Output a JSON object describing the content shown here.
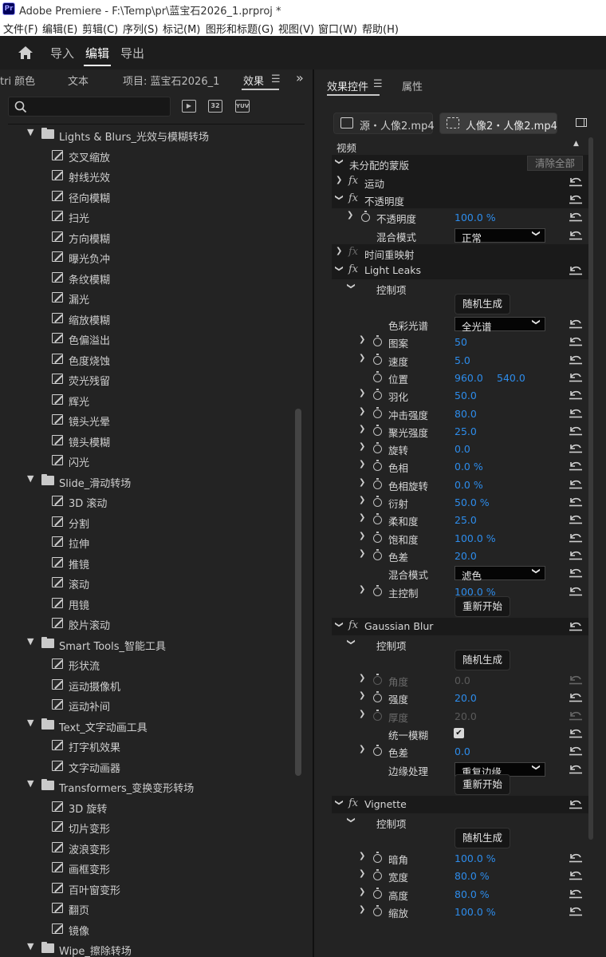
{
  "titlebar": {
    "logo": "Pr",
    "title": "Adobe Premiere - F:\\Temp\\pr\\蓝宝石2026_1.prproj *"
  },
  "menubar": [
    "文件(F)",
    "编辑(E)",
    "剪辑(C)",
    "序列(S)",
    "标记(M)",
    "图形和标题(G)",
    "视图(V)",
    "窗口(W)",
    "帮助(H)"
  ],
  "workspace": {
    "tabs": [
      "导入",
      "编辑",
      "导出"
    ],
    "active": "编辑"
  },
  "left_panel": {
    "tabs": [
      "tri 颜色",
      "文本",
      "项目: 蓝宝石2026_1",
      "效果"
    ],
    "active_tab": "效果",
    "search": {
      "value": "",
      "placeholder": ""
    },
    "filter_icons": [
      "加速",
      "32",
      "YUV"
    ],
    "tree": [
      {
        "type": "folder",
        "label": "Lights & Blurs_光效与模糊转场"
      },
      {
        "type": "item",
        "label": "交叉缩放"
      },
      {
        "type": "item",
        "label": "射线光效"
      },
      {
        "type": "item",
        "label": "径向模糊"
      },
      {
        "type": "item",
        "label": "扫光"
      },
      {
        "type": "item",
        "label": "方向模糊"
      },
      {
        "type": "item",
        "label": "曝光负冲"
      },
      {
        "type": "item",
        "label": "条纹模糊"
      },
      {
        "type": "item",
        "label": "漏光"
      },
      {
        "type": "item",
        "label": "缩放模糊"
      },
      {
        "type": "item",
        "label": "色偏溢出"
      },
      {
        "type": "item",
        "label": "色度烧蚀"
      },
      {
        "type": "item",
        "label": "荧光残留"
      },
      {
        "type": "item",
        "label": "辉光"
      },
      {
        "type": "item",
        "label": "镜头光晕"
      },
      {
        "type": "item",
        "label": "镜头模糊"
      },
      {
        "type": "item",
        "label": "闪光"
      },
      {
        "type": "folder",
        "label": "Slide_滑动转场"
      },
      {
        "type": "item",
        "label": "3D 滚动"
      },
      {
        "type": "item",
        "label": "分割"
      },
      {
        "type": "item",
        "label": "拉伸"
      },
      {
        "type": "item",
        "label": "推镜"
      },
      {
        "type": "item",
        "label": "滚动"
      },
      {
        "type": "item",
        "label": "甩镜"
      },
      {
        "type": "item",
        "label": "胶片滚动"
      },
      {
        "type": "folder",
        "label": "Smart Tools_智能工具"
      },
      {
        "type": "item",
        "label": "形状流"
      },
      {
        "type": "item",
        "label": "运动摄像机"
      },
      {
        "type": "item",
        "label": "运动补间"
      },
      {
        "type": "folder",
        "label": "Text_文字动画工具"
      },
      {
        "type": "item",
        "label": "打字机效果"
      },
      {
        "type": "item",
        "label": "文字动画器"
      },
      {
        "type": "folder",
        "label": "Transformers_变换变形转场"
      },
      {
        "type": "item",
        "label": "3D 旋转"
      },
      {
        "type": "item",
        "label": "切片变形"
      },
      {
        "type": "item",
        "label": "波浪变形"
      },
      {
        "type": "item",
        "label": "画框变形"
      },
      {
        "type": "item",
        "label": "百叶窗变形"
      },
      {
        "type": "item",
        "label": "翻页"
      },
      {
        "type": "item",
        "label": "镜像"
      },
      {
        "type": "folder",
        "label": "Wipe_擦除转场"
      }
    ]
  },
  "right_panel": {
    "tabs": [
      "效果控件",
      "属性"
    ],
    "active_tab": "效果控件",
    "source_tab": "源・人像2.mp4",
    "clip_tab": "人像2・人像2.mp4",
    "rows": [
      {
        "kind": "section",
        "label": "视频"
      },
      {
        "kind": "mask",
        "label": "未分配的蒙版",
        "clear": "清除全部"
      },
      {
        "kind": "effect",
        "label": "运动",
        "open": false
      },
      {
        "kind": "effect",
        "label": "不透明度",
        "open": true
      },
      {
        "kind": "param",
        "label": "不透明度",
        "value": "100.0 %",
        "sw": true,
        "exp": true,
        "ind": 1
      },
      {
        "kind": "dropdown",
        "label": "混合模式",
        "value": "正常",
        "ind": 1
      },
      {
        "kind": "effect",
        "label": "时间重映射",
        "open": false,
        "dim_fx": true
      },
      {
        "kind": "effect",
        "label": "Light Leaks",
        "open": true
      },
      {
        "kind": "group",
        "label": "控制项"
      },
      {
        "kind": "button",
        "label": "随机生成"
      },
      {
        "kind": "dropdown",
        "label": "色彩光谱",
        "value": "全光谱",
        "ind": 2
      },
      {
        "kind": "param",
        "label": "图案",
        "value": "50",
        "sw": true,
        "exp": true,
        "ind": 2
      },
      {
        "kind": "param",
        "label": "速度",
        "value": "5.0",
        "sw": true,
        "exp": true,
        "ind": 2
      },
      {
        "kind": "param",
        "label": "位置",
        "value": "960.0",
        "value2": "540.0",
        "sw": true,
        "exp": false,
        "ind": 2
      },
      {
        "kind": "param",
        "label": "羽化",
        "value": "50.0",
        "sw": true,
        "exp": true,
        "ind": 2
      },
      {
        "kind": "param",
        "label": "冲击强度",
        "value": "80.0",
        "sw": true,
        "exp": true,
        "ind": 2
      },
      {
        "kind": "param",
        "label": "聚光强度",
        "value": "25.0",
        "sw": true,
        "exp": true,
        "ind": 2
      },
      {
        "kind": "param",
        "label": "旋转",
        "value": "0.0",
        "sw": true,
        "exp": true,
        "ind": 2
      },
      {
        "kind": "param",
        "label": "色相",
        "value": "0.0 %",
        "sw": true,
        "exp": true,
        "ind": 2
      },
      {
        "kind": "param",
        "label": "色相旋转",
        "value": "0.0 %",
        "sw": true,
        "exp": true,
        "ind": 2
      },
      {
        "kind": "param",
        "label": "衍射",
        "value": "50.0 %",
        "sw": true,
        "exp": true,
        "ind": 2
      },
      {
        "kind": "param",
        "label": "柔和度",
        "value": "25.0",
        "sw": true,
        "exp": true,
        "ind": 2
      },
      {
        "kind": "param",
        "label": "饱和度",
        "value": "100.0 %",
        "sw": true,
        "exp": true,
        "ind": 2
      },
      {
        "kind": "param",
        "label": "色差",
        "value": "20.0",
        "sw": true,
        "exp": true,
        "ind": 2
      },
      {
        "kind": "dropdown",
        "label": "混合模式",
        "value": "滤色",
        "ind": 2
      },
      {
        "kind": "param",
        "label": "主控制",
        "value": "100.0 %",
        "sw": true,
        "exp": true,
        "ind": 2
      },
      {
        "kind": "button",
        "label": "重新开始"
      },
      {
        "kind": "effect",
        "label": "Gaussian Blur",
        "open": true
      },
      {
        "kind": "group",
        "label": "控制项"
      },
      {
        "kind": "button",
        "label": "随机生成"
      },
      {
        "kind": "param",
        "label": "角度",
        "value": "0.0",
        "sw": true,
        "exp": true,
        "ind": 2,
        "dim": true
      },
      {
        "kind": "param",
        "label": "强度",
        "value": "20.0",
        "sw": true,
        "exp": true,
        "ind": 2
      },
      {
        "kind": "param",
        "label": "厚度",
        "value": "20.0",
        "sw": true,
        "exp": true,
        "ind": 2,
        "dim": true
      },
      {
        "kind": "check",
        "label": "统一模糊",
        "checked": true
      },
      {
        "kind": "param",
        "label": "色差",
        "value": "0.0",
        "sw": true,
        "exp": true,
        "ind": 2
      },
      {
        "kind": "dropdown",
        "label": "边缘处理",
        "value": "重复边缘",
        "ind": 2
      },
      {
        "kind": "button",
        "label": "重新开始"
      },
      {
        "kind": "effect",
        "label": "Vignette",
        "open": true
      },
      {
        "kind": "group",
        "label": "控制项"
      },
      {
        "kind": "button",
        "label": "随机生成"
      },
      {
        "kind": "param",
        "label": "暗角",
        "value": "100.0 %",
        "sw": true,
        "exp": true,
        "ind": 2
      },
      {
        "kind": "param",
        "label": "宽度",
        "value": "80.0 %",
        "sw": true,
        "exp": true,
        "ind": 2
      },
      {
        "kind": "param",
        "label": "高度",
        "value": "80.0 %",
        "sw": true,
        "exp": true,
        "ind": 2
      },
      {
        "kind": "param",
        "label": "缩放",
        "value": "100.0 %",
        "sw": true,
        "exp": true,
        "ind": 2
      }
    ]
  },
  "colors": {
    "value_blue": "#2d8ceb",
    "panel_bg": "#232323",
    "app_bg": "#1d1d1d"
  }
}
